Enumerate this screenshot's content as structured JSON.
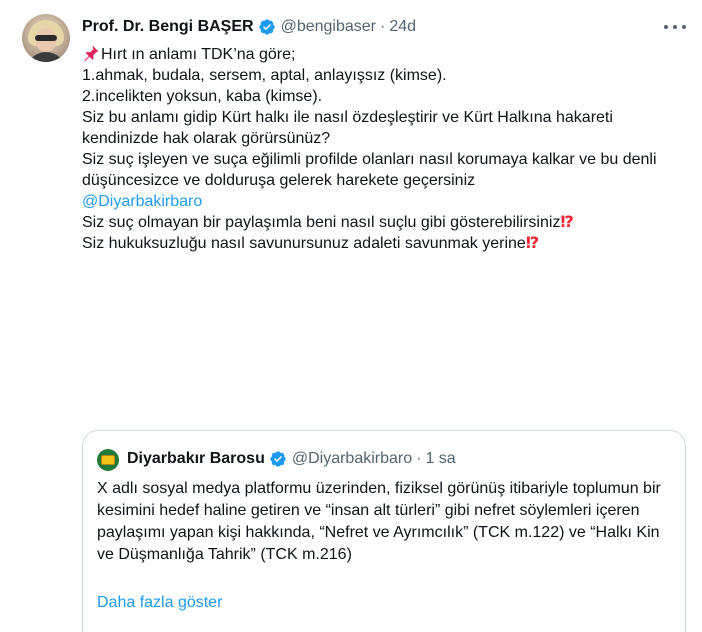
{
  "tweet": {
    "author_name": "Prof. Dr. Bengi BAŞER",
    "handle": "@bengibaser",
    "separator": "·",
    "time": "24d",
    "icons": [
      "verified-badge-icon",
      "more-options-icon",
      "pushpin-icon",
      "exclamation-question-icon"
    ],
    "lines": [
      "Hırt ın anlamı TDK’na göre;",
      "1.ahmak, budala, sersem, aptal, anlayışsız (kimse).",
      "2.incelikten yoksun, kaba (kimse).",
      "Siz bu anlamı gidip Kürt halkı ile nasıl özdeşleştirir ve Kürt Halkına hakareti kendinizde hak olarak görürsünüz?",
      "Siz suç işleyen ve suça eğilimli profilde olanları nasıl korumaya kalkar ve bu denli düşüncesizce ve dolduruşa gelerek harekete geçersiniz",
      "@Diyarbakirbaro",
      "Siz suç olmayan bir paylaşımla beni nasıl suçlu gibi gösterebilirsiniz",
      "Siz hukuksuzluğu nasıl savunursunuz adaleti savunmak yerine"
    ],
    "interrobang": "⁉"
  },
  "quote": {
    "author_name": "Diyarbakır Barosu",
    "handle": "@Diyarbakirbaro",
    "separator": "·",
    "time": "1 sa",
    "text": "X adlı sosyal medya platformu üzerinden, fiziksel görünüş itibariyle toplumun bir kesimini hedef haline getiren ve “insan alt türleri” gibi nefret söylemleri içeren paylaşımı yapan kişi hakkında, “Nefret ve Ayrımcılık” (TCK m.122) ve “Halkı Kin ve Düşmanlığa Tahrik” (TCK m.216)",
    "show_more": "Daha fazla göster"
  },
  "colors": {
    "text": "#0f1419",
    "secondary": "#536471",
    "link": "#1d9bf0",
    "border": "#cfd9de",
    "verified": "#1d9bf0",
    "emoji_red": "#f4212e"
  }
}
